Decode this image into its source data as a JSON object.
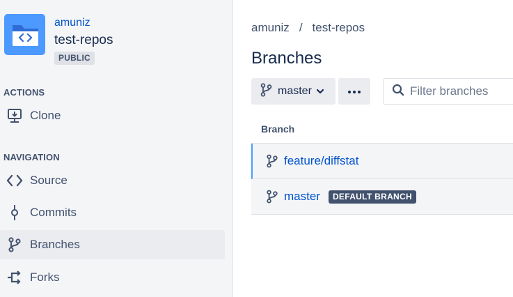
{
  "repo": {
    "owner": "amuniz",
    "name": "test-repos",
    "visibility": "PUBLIC",
    "avatar_icon": "code-folder-icon",
    "avatar_color": "#4c9aff"
  },
  "sidebar": {
    "actions_heading": "ACTIONS",
    "actions": [
      {
        "label": "Clone",
        "icon": "clone-icon"
      }
    ],
    "navigation_heading": "NAVIGATION",
    "navigation": [
      {
        "label": "Source",
        "icon": "code-icon"
      },
      {
        "label": "Commits",
        "icon": "commit-icon"
      },
      {
        "label": "Branches",
        "icon": "branch-icon",
        "active": true
      },
      {
        "label": "Forks",
        "icon": "fork-icon"
      }
    ]
  },
  "breadcrumb": {
    "owner": "amuniz",
    "separator": "/",
    "repo": "test-repos"
  },
  "page": {
    "title": "Branches"
  },
  "toolbar": {
    "branch_selector_label": "master",
    "more_label": "•••",
    "filter_placeholder": "Filter branches"
  },
  "table": {
    "column_branch": "Branch",
    "rows": [
      {
        "name": "feature/diffstat",
        "selected": true
      },
      {
        "name": "master",
        "badge": "DEFAULT BRANCH"
      }
    ]
  },
  "colors": {
    "link": "#0052cc",
    "accent": "#4c9aff",
    "text": "#172b4d",
    "muted": "#42526e"
  }
}
